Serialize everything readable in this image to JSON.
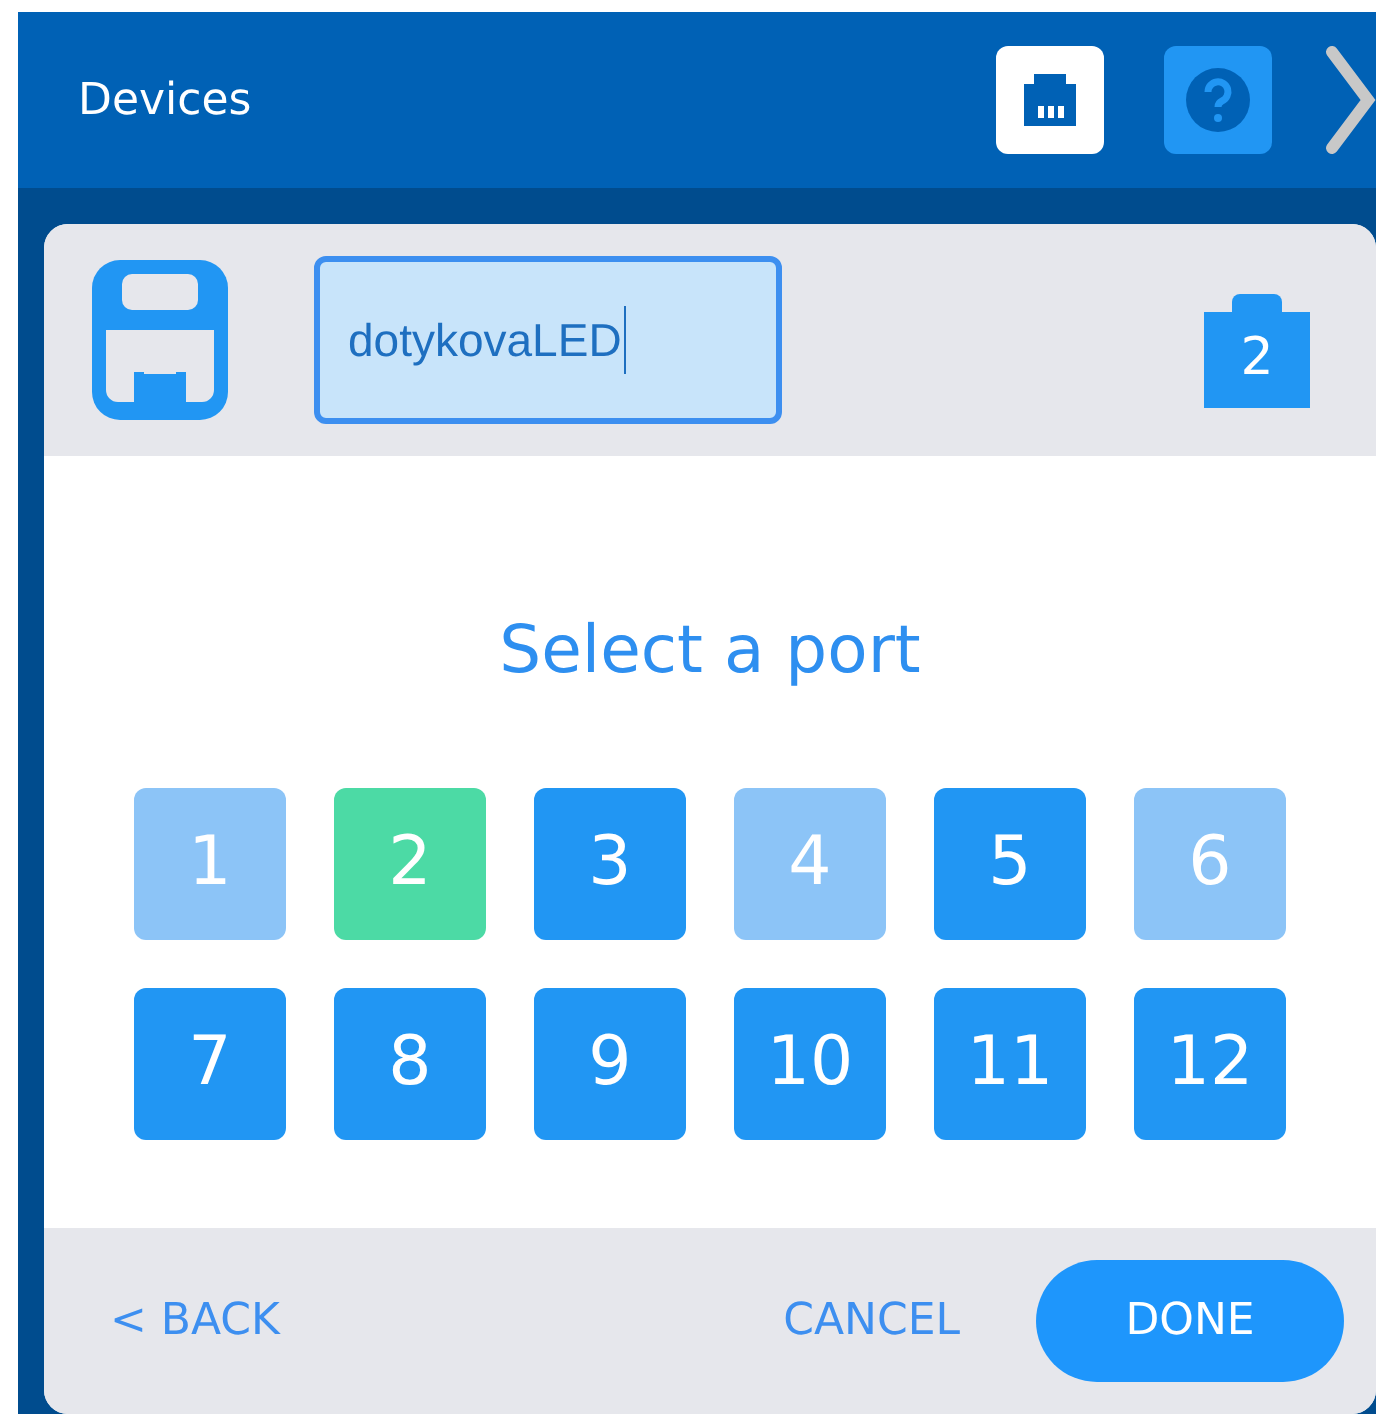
{
  "header": {
    "title": "Devices"
  },
  "device": {
    "name": "dotykovaLED",
    "port_badge": "2"
  },
  "prompt": "Select a port",
  "ports": [
    {
      "label": "1",
      "selected": false,
      "disabled": true
    },
    {
      "label": "2",
      "selected": true,
      "disabled": false
    },
    {
      "label": "3",
      "selected": false,
      "disabled": false
    },
    {
      "label": "4",
      "selected": false,
      "disabled": true
    },
    {
      "label": "5",
      "selected": false,
      "disabled": false
    },
    {
      "label": "6",
      "selected": false,
      "disabled": true
    },
    {
      "label": "7",
      "selected": false,
      "disabled": false
    },
    {
      "label": "8",
      "selected": false,
      "disabled": false
    },
    {
      "label": "9",
      "selected": false,
      "disabled": false
    },
    {
      "label": "10",
      "selected": false,
      "disabled": false
    },
    {
      "label": "11",
      "selected": false,
      "disabled": false
    },
    {
      "label": "12",
      "selected": false,
      "disabled": false
    }
  ],
  "footer": {
    "back": "< BACK",
    "cancel": "CANCEL",
    "done": "DONE"
  }
}
